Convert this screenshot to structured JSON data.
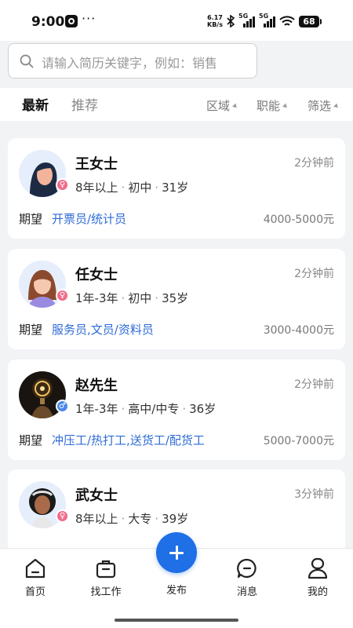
{
  "status_bar": {
    "time": "9:00",
    "dots": "···",
    "net_speed_value": "6.17",
    "net_speed_unit": "KB/s",
    "signal_1": "5G",
    "signal_2": "5G",
    "battery": "68",
    "icons": [
      "app-badge-icon",
      "bluetooth-icon",
      "signal-icon",
      "signal-icon",
      "wifi-icon",
      "battery-icon"
    ]
  },
  "search": {
    "placeholder": "请输入简历关键字，例如：销售",
    "icon": "search-icon"
  },
  "tabs": {
    "latest": "最新",
    "recommend": "推荐"
  },
  "filters": {
    "region": "区域",
    "function": "职能",
    "screen": "筛选"
  },
  "cards": [
    {
      "name": "王女士",
      "time": "2分钟前",
      "experience": "8年以上",
      "education": "初中",
      "age": "31岁",
      "expect_label": "期望",
      "expect_jobs": "开票员/统计员",
      "salary": "4000-5000元",
      "gender": "female",
      "gender_symbol": "♀"
    },
    {
      "name": "任女士",
      "time": "2分钟前",
      "experience": "1年-3年",
      "education": "初中",
      "age": "35岁",
      "expect_label": "期望",
      "expect_jobs": "服务员,文员/资料员",
      "salary": "3000-4000元",
      "gender": "female",
      "gender_symbol": "♀"
    },
    {
      "name": "赵先生",
      "time": "2分钟前",
      "experience": "1年-3年",
      "education": "高中/中专",
      "age": "36岁",
      "expect_label": "期望",
      "expect_jobs": "冲压工/热打工,送货工/配货工",
      "salary": "5000-7000元",
      "gender": "male",
      "gender_symbol": "♂"
    },
    {
      "name": "武女士",
      "time": "3分钟前",
      "experience": "8年以上",
      "education": "大专",
      "age": "39岁",
      "gender": "female",
      "gender_symbol": "♀"
    }
  ],
  "bottom_nav": {
    "home": "首页",
    "find_job": "找工作",
    "publish": "发布",
    "messages": "消息",
    "mine": "我的"
  },
  "colors": {
    "accent": "#1f6fe6",
    "link": "#2d6bd6",
    "female_badge": "#f06c8a",
    "male_badge": "#4a86e8",
    "page_bg": "#f2f3f5"
  }
}
